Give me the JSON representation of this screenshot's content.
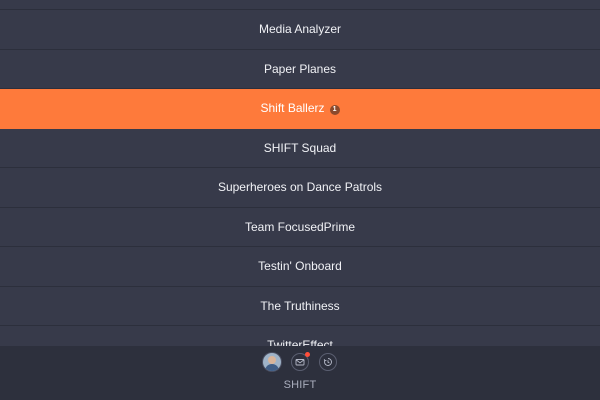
{
  "teams": [
    {
      "name": "Media Analyzer",
      "selected": false,
      "badge": ""
    },
    {
      "name": "Paper Planes",
      "selected": false,
      "badge": ""
    },
    {
      "name": "Shift Ballerz",
      "selected": true,
      "badge": "1"
    },
    {
      "name": "SHIFT Squad",
      "selected": false,
      "badge": ""
    },
    {
      "name": "Superheroes on Dance Patrols",
      "selected": false,
      "badge": ""
    },
    {
      "name": "Team FocusedPrime",
      "selected": false,
      "badge": ""
    },
    {
      "name": "Testin' Onboard",
      "selected": false,
      "badge": ""
    },
    {
      "name": "The Truthiness",
      "selected": false,
      "badge": ""
    },
    {
      "name": "TwitterEffect",
      "selected": false,
      "badge": ""
    }
  ],
  "bottom_bar": {
    "icons": [
      "avatar",
      "mail-icon",
      "history-icon"
    ],
    "mail_has_notification": true,
    "brand": "SHIFT"
  },
  "colors": {
    "background": "#373a4a",
    "selected": "#fe7a3b",
    "bottom_bar": "#2d303d",
    "notification": "#ff4e3a"
  }
}
